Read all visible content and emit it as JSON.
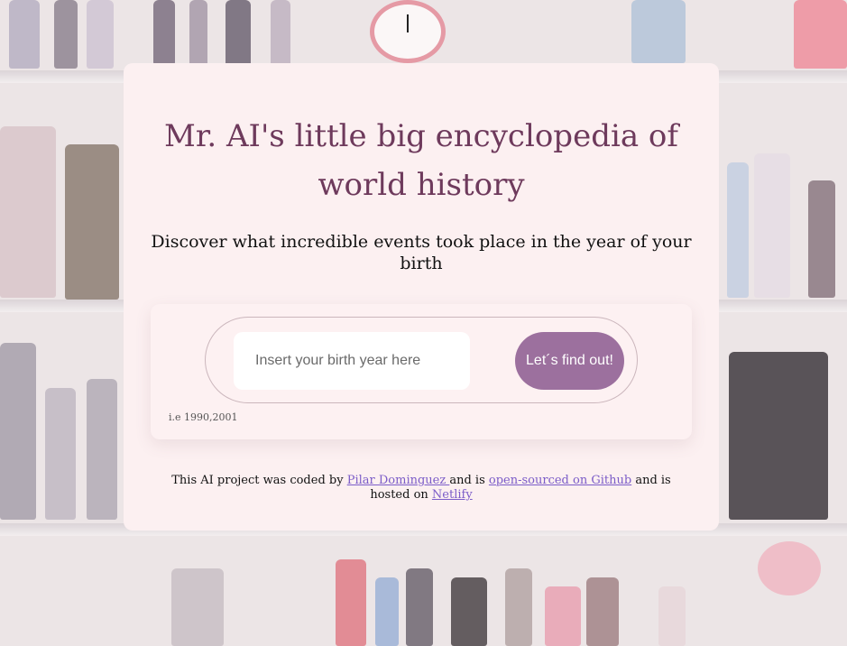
{
  "page": {
    "title": "Mr. AI's little big encyclopedia of world history",
    "subtitle": "Discover what incredible events took place in the year of your birth"
  },
  "search": {
    "placeholder": "Insert your birth year here",
    "value": "",
    "button_label": "Let´s find out!",
    "hint": "i.e 1990,2001"
  },
  "footer": {
    "text_1": "This AI project was coded by ",
    "author_link": "Pilar Dominguez ",
    "text_2": "and is ",
    "github_link": "open-sourced on Github",
    "text_3": " and is hosted on ",
    "netlify_link": "Netlify"
  },
  "colors": {
    "title": "#6e3a5c",
    "button": "#9c709e",
    "card": "#fcf0f1",
    "link": "#7b5cc8"
  }
}
